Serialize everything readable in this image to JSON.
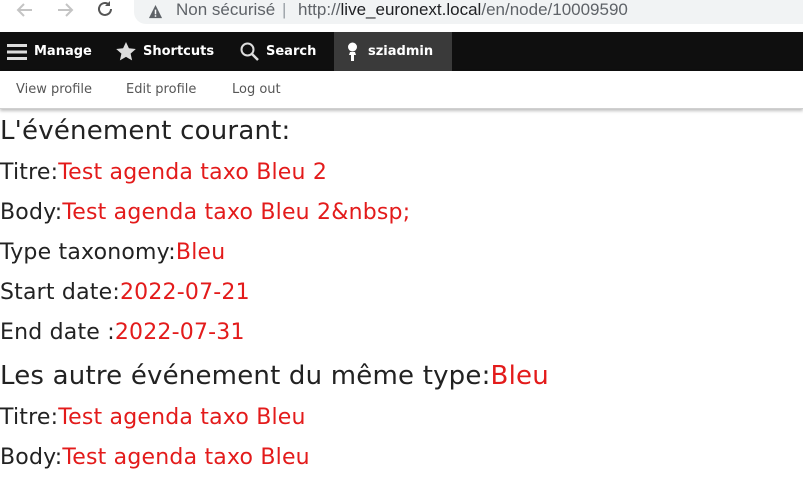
{
  "browser": {
    "security_label": "Non sécurisé",
    "separator": "|",
    "url_prefix": "http://",
    "url_host": "live_euronext.local",
    "url_path": "/en/node/10009590"
  },
  "toolbar": {
    "manage": "Manage",
    "shortcuts": "Shortcuts",
    "search": "Search",
    "user": "sziadmin"
  },
  "tray": {
    "view_profile": "View profile",
    "edit_profile": "Edit profile",
    "log_out": "Log out"
  },
  "content": {
    "current_heading": "L'événement courant:",
    "current": {
      "title_label": "Titre:",
      "title_value": "Test agenda taxo Bleu 2",
      "body_label": "Body:",
      "body_value": "Test agenda taxo Bleu 2&nbsp;",
      "type_label": "Type taxonomy:",
      "type_value": "Bleu",
      "start_label": "Start date:",
      "start_value": "2022-07-21",
      "end_label": "End date :",
      "end_value": "2022-07-31"
    },
    "others_heading": "Les autre événement du même type:",
    "others_type": "Bleu",
    "other": {
      "title_label": "Titre:",
      "title_value": "Test agenda taxo Bleu",
      "body_label": "Body:",
      "body_value": "Test agenda taxo Bleu"
    }
  },
  "colors": {
    "value_red": "#e31b1b",
    "toolbar_bg": "#0f0f0f",
    "toolbar_active": "#3a3a3a"
  }
}
